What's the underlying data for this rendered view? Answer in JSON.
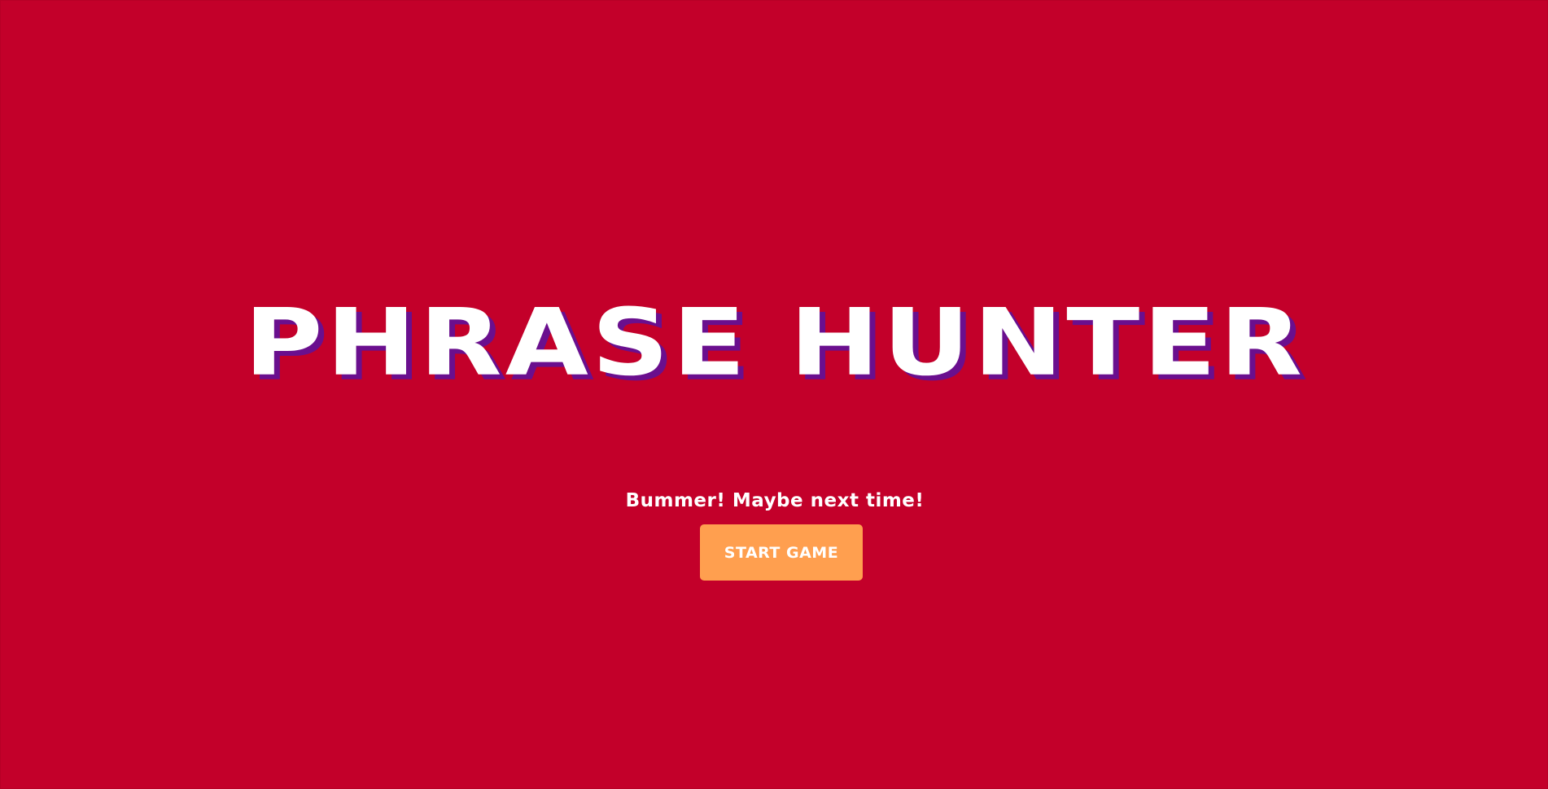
{
  "overlay": {
    "title": "PHRASE HUNTER",
    "message": "Bummer! Maybe next time!",
    "start_button_label": "START GAME"
  },
  "colors": {
    "background": "#c3002a",
    "title_shadow": "#6a0f8e",
    "button": "#ff9f4f",
    "text": "#ffffff"
  }
}
